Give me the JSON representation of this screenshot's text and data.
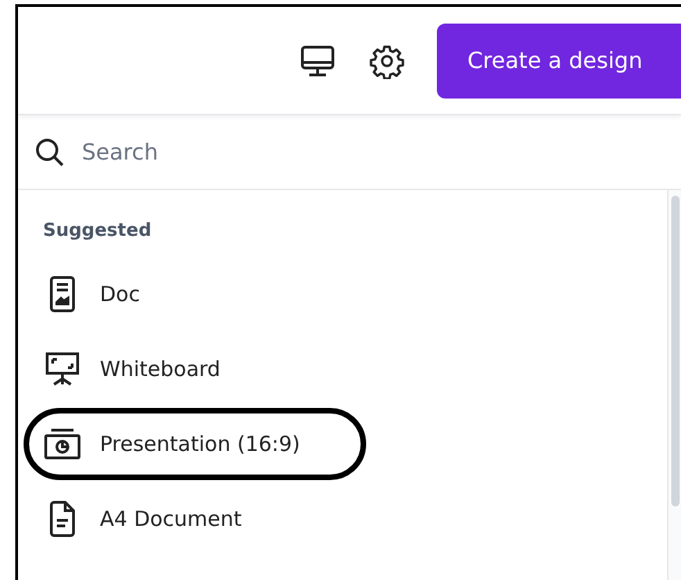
{
  "header": {
    "create_button": "Create a design"
  },
  "search": {
    "placeholder": "Search"
  },
  "section_title": "Suggested",
  "items": [
    {
      "label": "Doc",
      "kind": "doc",
      "circled": false
    },
    {
      "label": "Whiteboard",
      "kind": "whiteboard",
      "circled": false
    },
    {
      "label": "Presentation (16:9)",
      "kind": "presentation",
      "circled": true
    },
    {
      "label": "A4 Document",
      "kind": "document",
      "circled": false
    }
  ]
}
